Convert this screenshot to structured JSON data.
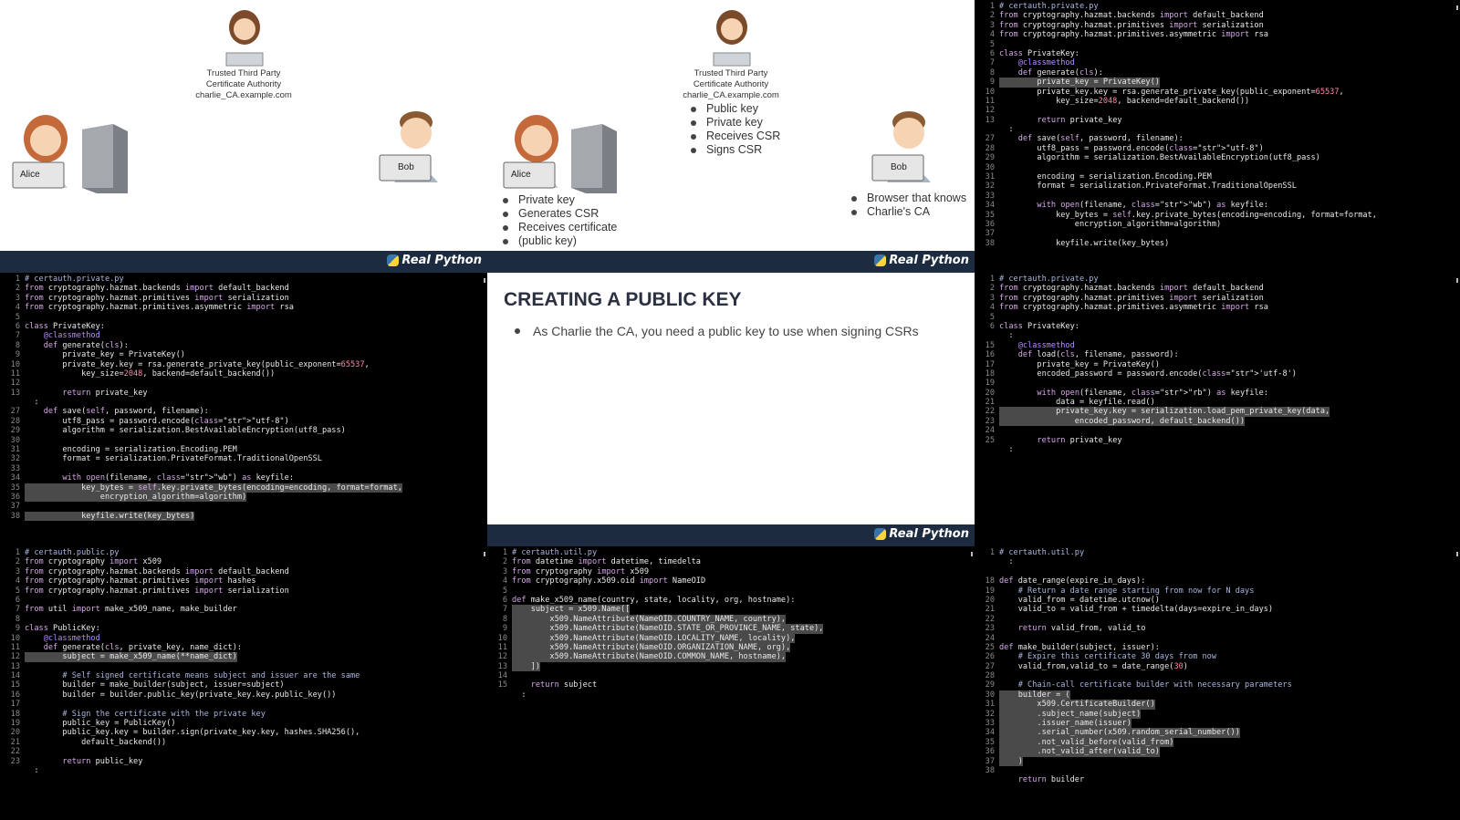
{
  "top_left_slide": {
    "ca_caption": [
      "Trusted Third Party",
      "Certificate Authority",
      "charlie_CA.example.com"
    ],
    "alice_label": "Alice",
    "bob_label": "Bob"
  },
  "top_middle_slide": {
    "ca_caption": [
      "Trusted Third Party",
      "Certificate Authority",
      "charlie_CA.example.com"
    ],
    "ca_bullets": [
      "Public key",
      "Private key",
      "Receives CSR",
      "Signs CSR"
    ],
    "alice_label": "Alice",
    "alice_bullets": [
      "Private key",
      "Generates CSR",
      "Receives certificate",
      "(public key)"
    ],
    "bob_label": "Bob",
    "bob_bullets": [
      "Browser that knows",
      "Charlie's CA"
    ]
  },
  "center_slide": {
    "title": "CREATING A PUBLIC KEY",
    "bullet": "As Charlie the CA, you need a public key to use when signing CSRs"
  },
  "brand": {
    "logo_text": "Real Python"
  },
  "code_panes": {
    "top_right": [
      {
        "n": "1",
        "t": "# certauth.private.py"
      },
      {
        "n": "2",
        "t": "from cryptography.hazmat.backends import default_backend"
      },
      {
        "n": "3",
        "t": "from cryptography.hazmat.primitives import serialization"
      },
      {
        "n": "4",
        "t": "from cryptography.hazmat.primitives.asymmetric import rsa"
      },
      {
        "n": "5",
        "t": ""
      },
      {
        "n": "6",
        "t": "class PrivateKey:"
      },
      {
        "n": "7",
        "t": "    @classmethod"
      },
      {
        "n": "8",
        "t": "    def generate(cls):"
      },
      {
        "n": "9",
        "t": "        private_key = PrivateKey()",
        "h": true
      },
      {
        "n": "10",
        "t": "        private_key.key = rsa.generate_private_key(public_exponent=65537,"
      },
      {
        "n": "11",
        "t": "            key_size=2048, backend=default_backend())"
      },
      {
        "n": "12",
        "t": ""
      },
      {
        "n": "13",
        "t": "        return private_key"
      },
      {
        "n": "",
        "t": "  :"
      },
      {
        "n": "27",
        "t": "    def save(self, password, filename):"
      },
      {
        "n": "28",
        "t": "        utf8_pass = password.encode(\"utf-8\")"
      },
      {
        "n": "29",
        "t": "        algorithm = serialization.BestAvailableEncryption(utf8_pass)"
      },
      {
        "n": "30",
        "t": ""
      },
      {
        "n": "31",
        "t": "        encoding = serialization.Encoding.PEM"
      },
      {
        "n": "32",
        "t": "        format = serialization.PrivateFormat.TraditionalOpenSSL"
      },
      {
        "n": "33",
        "t": ""
      },
      {
        "n": "34",
        "t": "        with open(filename, \"wb\") as keyfile:"
      },
      {
        "n": "35",
        "t": "            key_bytes = self.key.private_bytes(encoding=encoding, format=format,"
      },
      {
        "n": "36",
        "t": "                encryption_algorithm=algorithm)"
      },
      {
        "n": "37",
        "t": ""
      },
      {
        "n": "38",
        "t": "            keyfile.write(key_bytes)"
      }
    ],
    "middle_left": [
      {
        "n": "1",
        "t": "# certauth.private.py"
      },
      {
        "n": "2",
        "t": "from cryptography.hazmat.backends import default_backend"
      },
      {
        "n": "3",
        "t": "from cryptography.hazmat.primitives import serialization"
      },
      {
        "n": "4",
        "t": "from cryptography.hazmat.primitives.asymmetric import rsa"
      },
      {
        "n": "5",
        "t": ""
      },
      {
        "n": "6",
        "t": "class PrivateKey:"
      },
      {
        "n": "7",
        "t": "    @classmethod"
      },
      {
        "n": "8",
        "t": "    def generate(cls):"
      },
      {
        "n": "9",
        "t": "        private_key = PrivateKey()"
      },
      {
        "n": "10",
        "t": "        private_key.key = rsa.generate_private_key(public_exponent=65537,"
      },
      {
        "n": "11",
        "t": "            key_size=2048, backend=default_backend())"
      },
      {
        "n": "12",
        "t": ""
      },
      {
        "n": "13",
        "t": "        return private_key"
      },
      {
        "n": "",
        "t": "  :"
      },
      {
        "n": "27",
        "t": "    def save(self, password, filename):"
      },
      {
        "n": "28",
        "t": "        utf8_pass = password.encode(\"utf-8\")"
      },
      {
        "n": "29",
        "t": "        algorithm = serialization.BestAvailableEncryption(utf8_pass)"
      },
      {
        "n": "30",
        "t": ""
      },
      {
        "n": "31",
        "t": "        encoding = serialization.Encoding.PEM"
      },
      {
        "n": "32",
        "t": "        format = serialization.PrivateFormat.TraditionalOpenSSL"
      },
      {
        "n": "33",
        "t": ""
      },
      {
        "n": "34",
        "t": "        with open(filename, \"wb\") as keyfile:"
      },
      {
        "n": "35",
        "t": "            key_bytes = self.key.private_bytes(encoding=encoding, format=format,",
        "h": true
      },
      {
        "n": "36",
        "t": "                encryption_algorithm=algorithm)",
        "h": true
      },
      {
        "n": "37",
        "t": ""
      },
      {
        "n": "38",
        "t": "            keyfile.write(key_bytes)",
        "h": true
      }
    ],
    "middle_right": [
      {
        "n": "1",
        "t": "# certauth.private.py"
      },
      {
        "n": "2",
        "t": "from cryptography.hazmat.backends import default_backend"
      },
      {
        "n": "3",
        "t": "from cryptography.hazmat.primitives import serialization"
      },
      {
        "n": "4",
        "t": "from cryptography.hazmat.primitives.asymmetric import rsa"
      },
      {
        "n": "5",
        "t": ""
      },
      {
        "n": "6",
        "t": "class PrivateKey:"
      },
      {
        "n": "",
        "t": "  :"
      },
      {
        "n": "15",
        "t": "    @classmethod"
      },
      {
        "n": "16",
        "t": "    def load(cls, filename, password):"
      },
      {
        "n": "17",
        "t": "        private_key = PrivateKey()"
      },
      {
        "n": "18",
        "t": "        encoded_password = password.encode('utf-8')"
      },
      {
        "n": "19",
        "t": ""
      },
      {
        "n": "20",
        "t": "        with open(filename, \"rb\") as keyfile:"
      },
      {
        "n": "21",
        "t": "            data = keyfile.read()"
      },
      {
        "n": "22",
        "t": "            private_key.key = serialization.load_pem_private_key(data,",
        "h": true
      },
      {
        "n": "23",
        "t": "                encoded_password, default_backend())",
        "h": true
      },
      {
        "n": "24",
        "t": ""
      },
      {
        "n": "25",
        "t": "        return private_key"
      },
      {
        "n": "",
        "t": "  :"
      }
    ],
    "bottom_left": [
      {
        "n": "1",
        "t": "# certauth.public.py"
      },
      {
        "n": "2",
        "t": "from cryptography import x509"
      },
      {
        "n": "3",
        "t": "from cryptography.hazmat.backends import default_backend"
      },
      {
        "n": "4",
        "t": "from cryptography.hazmat.primitives import hashes"
      },
      {
        "n": "5",
        "t": "from cryptography.hazmat.primitives import serialization"
      },
      {
        "n": "6",
        "t": ""
      },
      {
        "n": "7",
        "t": "from util import make_x509_name, make_builder"
      },
      {
        "n": "8",
        "t": ""
      },
      {
        "n": "9",
        "t": "class PublicKey:"
      },
      {
        "n": "10",
        "t": "    @classmethod"
      },
      {
        "n": "11",
        "t": "    def generate(cls, private_key, name_dict):"
      },
      {
        "n": "12",
        "t": "        subject = make_x509_name(**name_dict)",
        "h": true
      },
      {
        "n": "13",
        "t": ""
      },
      {
        "n": "14",
        "t": "        # Self signed certificate means subject and issuer are the same"
      },
      {
        "n": "15",
        "t": "        builder = make_builder(subject, issuer=subject)"
      },
      {
        "n": "16",
        "t": "        builder = builder.public_key(private_key.key.public_key())"
      },
      {
        "n": "17",
        "t": ""
      },
      {
        "n": "18",
        "t": "        # Sign the certificate with the private key"
      },
      {
        "n": "19",
        "t": "        public_key = PublicKey()"
      },
      {
        "n": "20",
        "t": "        public_key.key = builder.sign(private_key.key, hashes.SHA256(),"
      },
      {
        "n": "21",
        "t": "            default_backend())"
      },
      {
        "n": "22",
        "t": ""
      },
      {
        "n": "23",
        "t": "        return public_key"
      },
      {
        "n": "",
        "t": "  :"
      }
    ],
    "bottom_middle": [
      {
        "n": "1",
        "t": "# certauth.util.py"
      },
      {
        "n": "2",
        "t": "from datetime import datetime, timedelta"
      },
      {
        "n": "3",
        "t": "from cryptography import x509"
      },
      {
        "n": "4",
        "t": "from cryptography.x509.oid import NameOID"
      },
      {
        "n": "5",
        "t": ""
      },
      {
        "n": "6",
        "t": "def make_x509_name(country, state, locality, org, hostname):"
      },
      {
        "n": "7",
        "t": "    subject = x509.Name([",
        "h": true
      },
      {
        "n": "8",
        "t": "        x509.NameAttribute(NameOID.COUNTRY_NAME, country),",
        "h": true
      },
      {
        "n": "9",
        "t": "        x509.NameAttribute(NameOID.STATE_OR_PROVINCE_NAME, state),",
        "h": true
      },
      {
        "n": "10",
        "t": "        x509.NameAttribute(NameOID.LOCALITY_NAME, locality),",
        "h": true
      },
      {
        "n": "11",
        "t": "        x509.NameAttribute(NameOID.ORGANIZATION_NAME, org),",
        "h": true
      },
      {
        "n": "12",
        "t": "        x509.NameAttribute(NameOID.COMMON_NAME, hostname),",
        "h": true
      },
      {
        "n": "13",
        "t": "    ])",
        "h": true
      },
      {
        "n": "14",
        "t": ""
      },
      {
        "n": "15",
        "t": "    return subject"
      },
      {
        "n": "",
        "t": "  :"
      }
    ],
    "bottom_right": [
      {
        "n": "1",
        "t": "# certauth.util.py"
      },
      {
        "n": "",
        "t": "  :"
      },
      {
        "n": "",
        "t": ""
      },
      {
        "n": "18",
        "t": "def date_range(expire_in_days):"
      },
      {
        "n": "19",
        "t": "    # Return a date range starting from now for N days"
      },
      {
        "n": "20",
        "t": "    valid_from = datetime.utcnow()"
      },
      {
        "n": "21",
        "t": "    valid_to = valid_from + timedelta(days=expire_in_days)"
      },
      {
        "n": "22",
        "t": ""
      },
      {
        "n": "23",
        "t": "    return valid_from, valid_to"
      },
      {
        "n": "24",
        "t": ""
      },
      {
        "n": "25",
        "t": "def make_builder(subject, issuer):"
      },
      {
        "n": "26",
        "t": "    # Expire this certificate 30 days from now"
      },
      {
        "n": "27",
        "t": "    valid_from,valid_to = date_range(30)"
      },
      {
        "n": "28",
        "t": ""
      },
      {
        "n": "29",
        "t": "    # Chain-call certificate builder with necessary parameters"
      },
      {
        "n": "30",
        "t": "    builder = (",
        "h": true
      },
      {
        "n": "31",
        "t": "        x509.CertificateBuilder()",
        "h": true
      },
      {
        "n": "32",
        "t": "        .subject_name(subject)",
        "h": true
      },
      {
        "n": "33",
        "t": "        .issuer_name(issuer)",
        "h": true
      },
      {
        "n": "34",
        "t": "        .serial_number(x509.random_serial_number())",
        "h": true
      },
      {
        "n": "35",
        "t": "        .not_valid_before(valid_from)",
        "h": true
      },
      {
        "n": "36",
        "t": "        .not_valid_after(valid_to)",
        "h": true
      },
      {
        "n": "37",
        "t": "    )",
        "h": true
      },
      {
        "n": "38",
        "t": ""
      },
      {
        "n": "",
        "t": "    return builder"
      }
    ]
  },
  "colors": {
    "slide_bar": "#1c2b40",
    "code_bg": "#000000",
    "highlight": "#4a4a4a"
  }
}
